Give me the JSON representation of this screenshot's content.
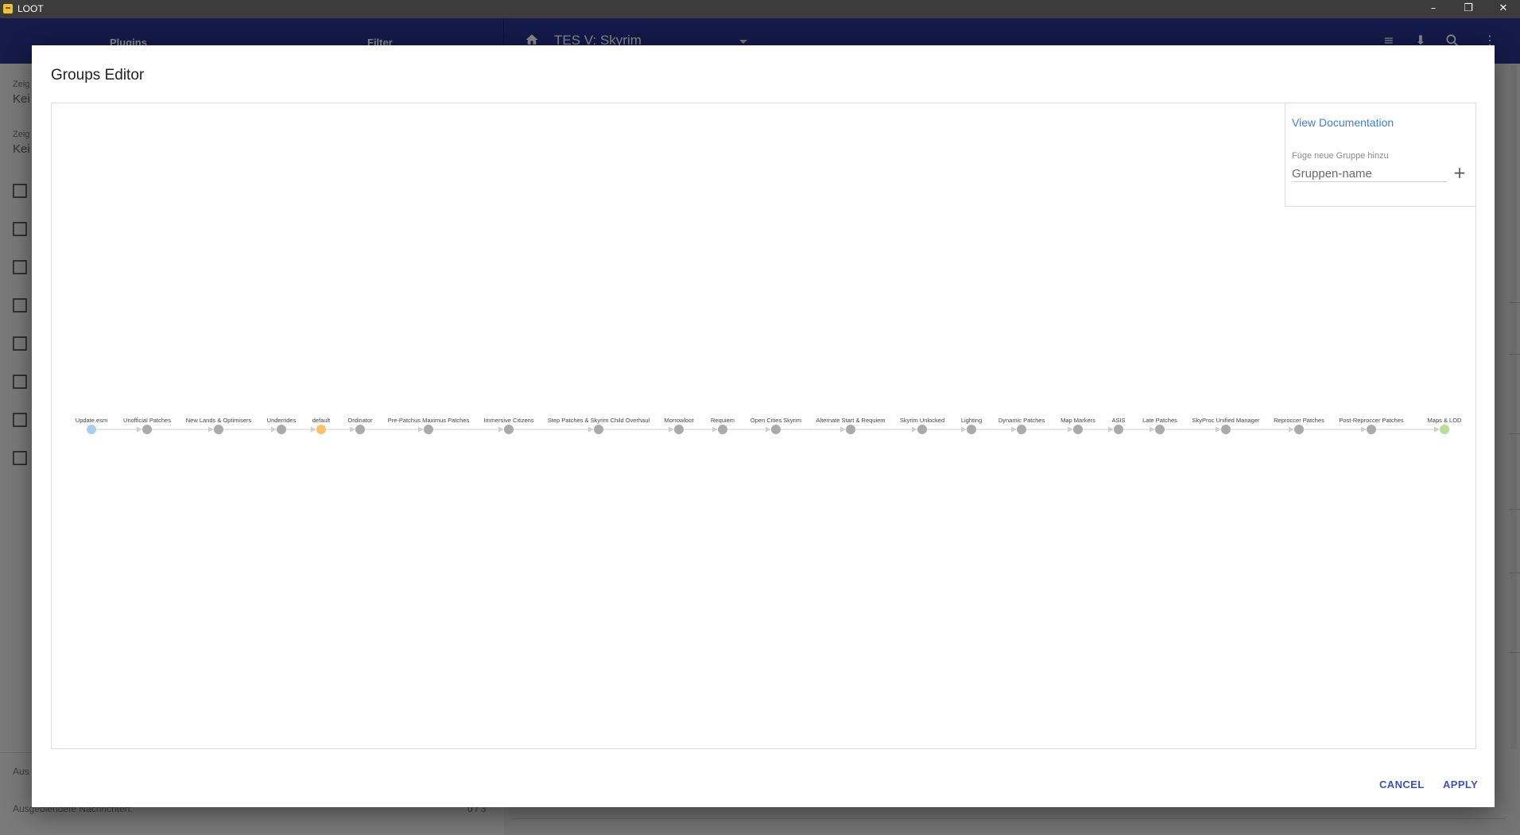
{
  "window": {
    "title": "LOOT",
    "minimize": "–",
    "restore": "❐",
    "close": "✕"
  },
  "background": {
    "tabs": [
      "Plugins",
      "Filter"
    ],
    "game_title": "TES V: Skyrim",
    "header_icons": [
      "sort-icon",
      "download-icon",
      "search-icon",
      "more-vert-icon"
    ],
    "sidebar": {
      "filter1_label": "Zeig",
      "filter1_value": "Kei",
      "filter2_label": "Zeig",
      "filter2_value": "Kei",
      "footer1": "Aus",
      "footer2": "Ausgeblendete Nachrichten:",
      "footer2_count": "0 / 3"
    }
  },
  "dialog": {
    "title": "Groups Editor",
    "doc_link": "View Documentation",
    "new_group_label": "Füge neue Gruppe hinzu",
    "new_group_placeholder": "Gruppen-name",
    "cancel": "CANCEL",
    "apply": "APPLY"
  },
  "graph": {
    "node_colors": {
      "first": "#aacfee",
      "default": "#f6c36a",
      "last": "#b6df9a",
      "normal": "#aaaaaa"
    },
    "nodes": [
      {
        "label": "Update.esm",
        "type": "first"
      },
      {
        "label": "Unofficial Patches",
        "type": "normal"
      },
      {
        "label": "New Lands & Optimisers",
        "type": "normal"
      },
      {
        "label": "Underrides",
        "type": "normal"
      },
      {
        "label": "default",
        "type": "default"
      },
      {
        "label": "Ordinator",
        "type": "normal"
      },
      {
        "label": "Pre-Patchus Maximus Patches",
        "type": "normal"
      },
      {
        "label": "Immersive Citizens",
        "type": "normal"
      },
      {
        "label": "Step Patches & Skyrim Child Overhaul",
        "type": "normal"
      },
      {
        "label": "Morrowloot",
        "type": "normal"
      },
      {
        "label": "Requiem",
        "type": "normal"
      },
      {
        "label": "Open Cities Skyrim",
        "type": "normal"
      },
      {
        "label": "Alternate Start & Requiem",
        "type": "normal"
      },
      {
        "label": "Skyrim Unlocked",
        "type": "normal"
      },
      {
        "label": "Lighting",
        "type": "normal"
      },
      {
        "label": "Dynamic Patches",
        "type": "normal"
      },
      {
        "label": "Map Markers",
        "type": "normal"
      },
      {
        "label": "ASIS",
        "type": "normal"
      },
      {
        "label": "Late Patches",
        "type": "normal"
      },
      {
        "label": "SkyProc Unified Manager",
        "type": "normal"
      },
      {
        "label": "Reproccer Patches",
        "type": "normal"
      },
      {
        "label": "Post-Reproccer Patches",
        "type": "normal"
      },
      {
        "label": "Maps & LOD",
        "type": "last"
      }
    ]
  }
}
